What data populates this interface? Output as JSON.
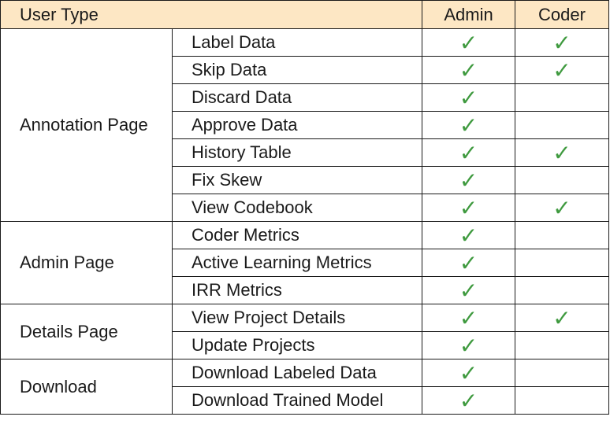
{
  "header": {
    "user_type": "User Type",
    "admin": "Admin",
    "coder": "Coder"
  },
  "check_glyph": "✓",
  "check_color": "#3f9a3f",
  "header_bg": "#fde7c4",
  "groups": [
    {
      "name": "Annotation Page",
      "rows": [
        {
          "label": "Label Data",
          "admin": true,
          "coder": true
        },
        {
          "label": "Skip Data",
          "admin": true,
          "coder": true
        },
        {
          "label": "Discard Data",
          "admin": true,
          "coder": false
        },
        {
          "label": "Approve Data",
          "admin": true,
          "coder": false
        },
        {
          "label": "History Table",
          "admin": true,
          "coder": true
        },
        {
          "label": "Fix Skew",
          "admin": true,
          "coder": false
        },
        {
          "label": "View Codebook",
          "admin": true,
          "coder": true
        }
      ]
    },
    {
      "name": "Admin Page",
      "rows": [
        {
          "label": "Coder Metrics",
          "admin": true,
          "coder": false
        },
        {
          "label": "Active Learning Metrics",
          "admin": true,
          "coder": false
        },
        {
          "label": "IRR Metrics",
          "admin": true,
          "coder": false
        }
      ]
    },
    {
      "name": "Details Page",
      "rows": [
        {
          "label": "View Project Details",
          "admin": true,
          "coder": true
        },
        {
          "label": "Update Projects",
          "admin": true,
          "coder": false
        }
      ]
    },
    {
      "name": "Download",
      "rows": [
        {
          "label": "Download Labeled Data",
          "admin": true,
          "coder": false
        },
        {
          "label": "Download Trained Model",
          "admin": true,
          "coder": false
        }
      ]
    }
  ]
}
